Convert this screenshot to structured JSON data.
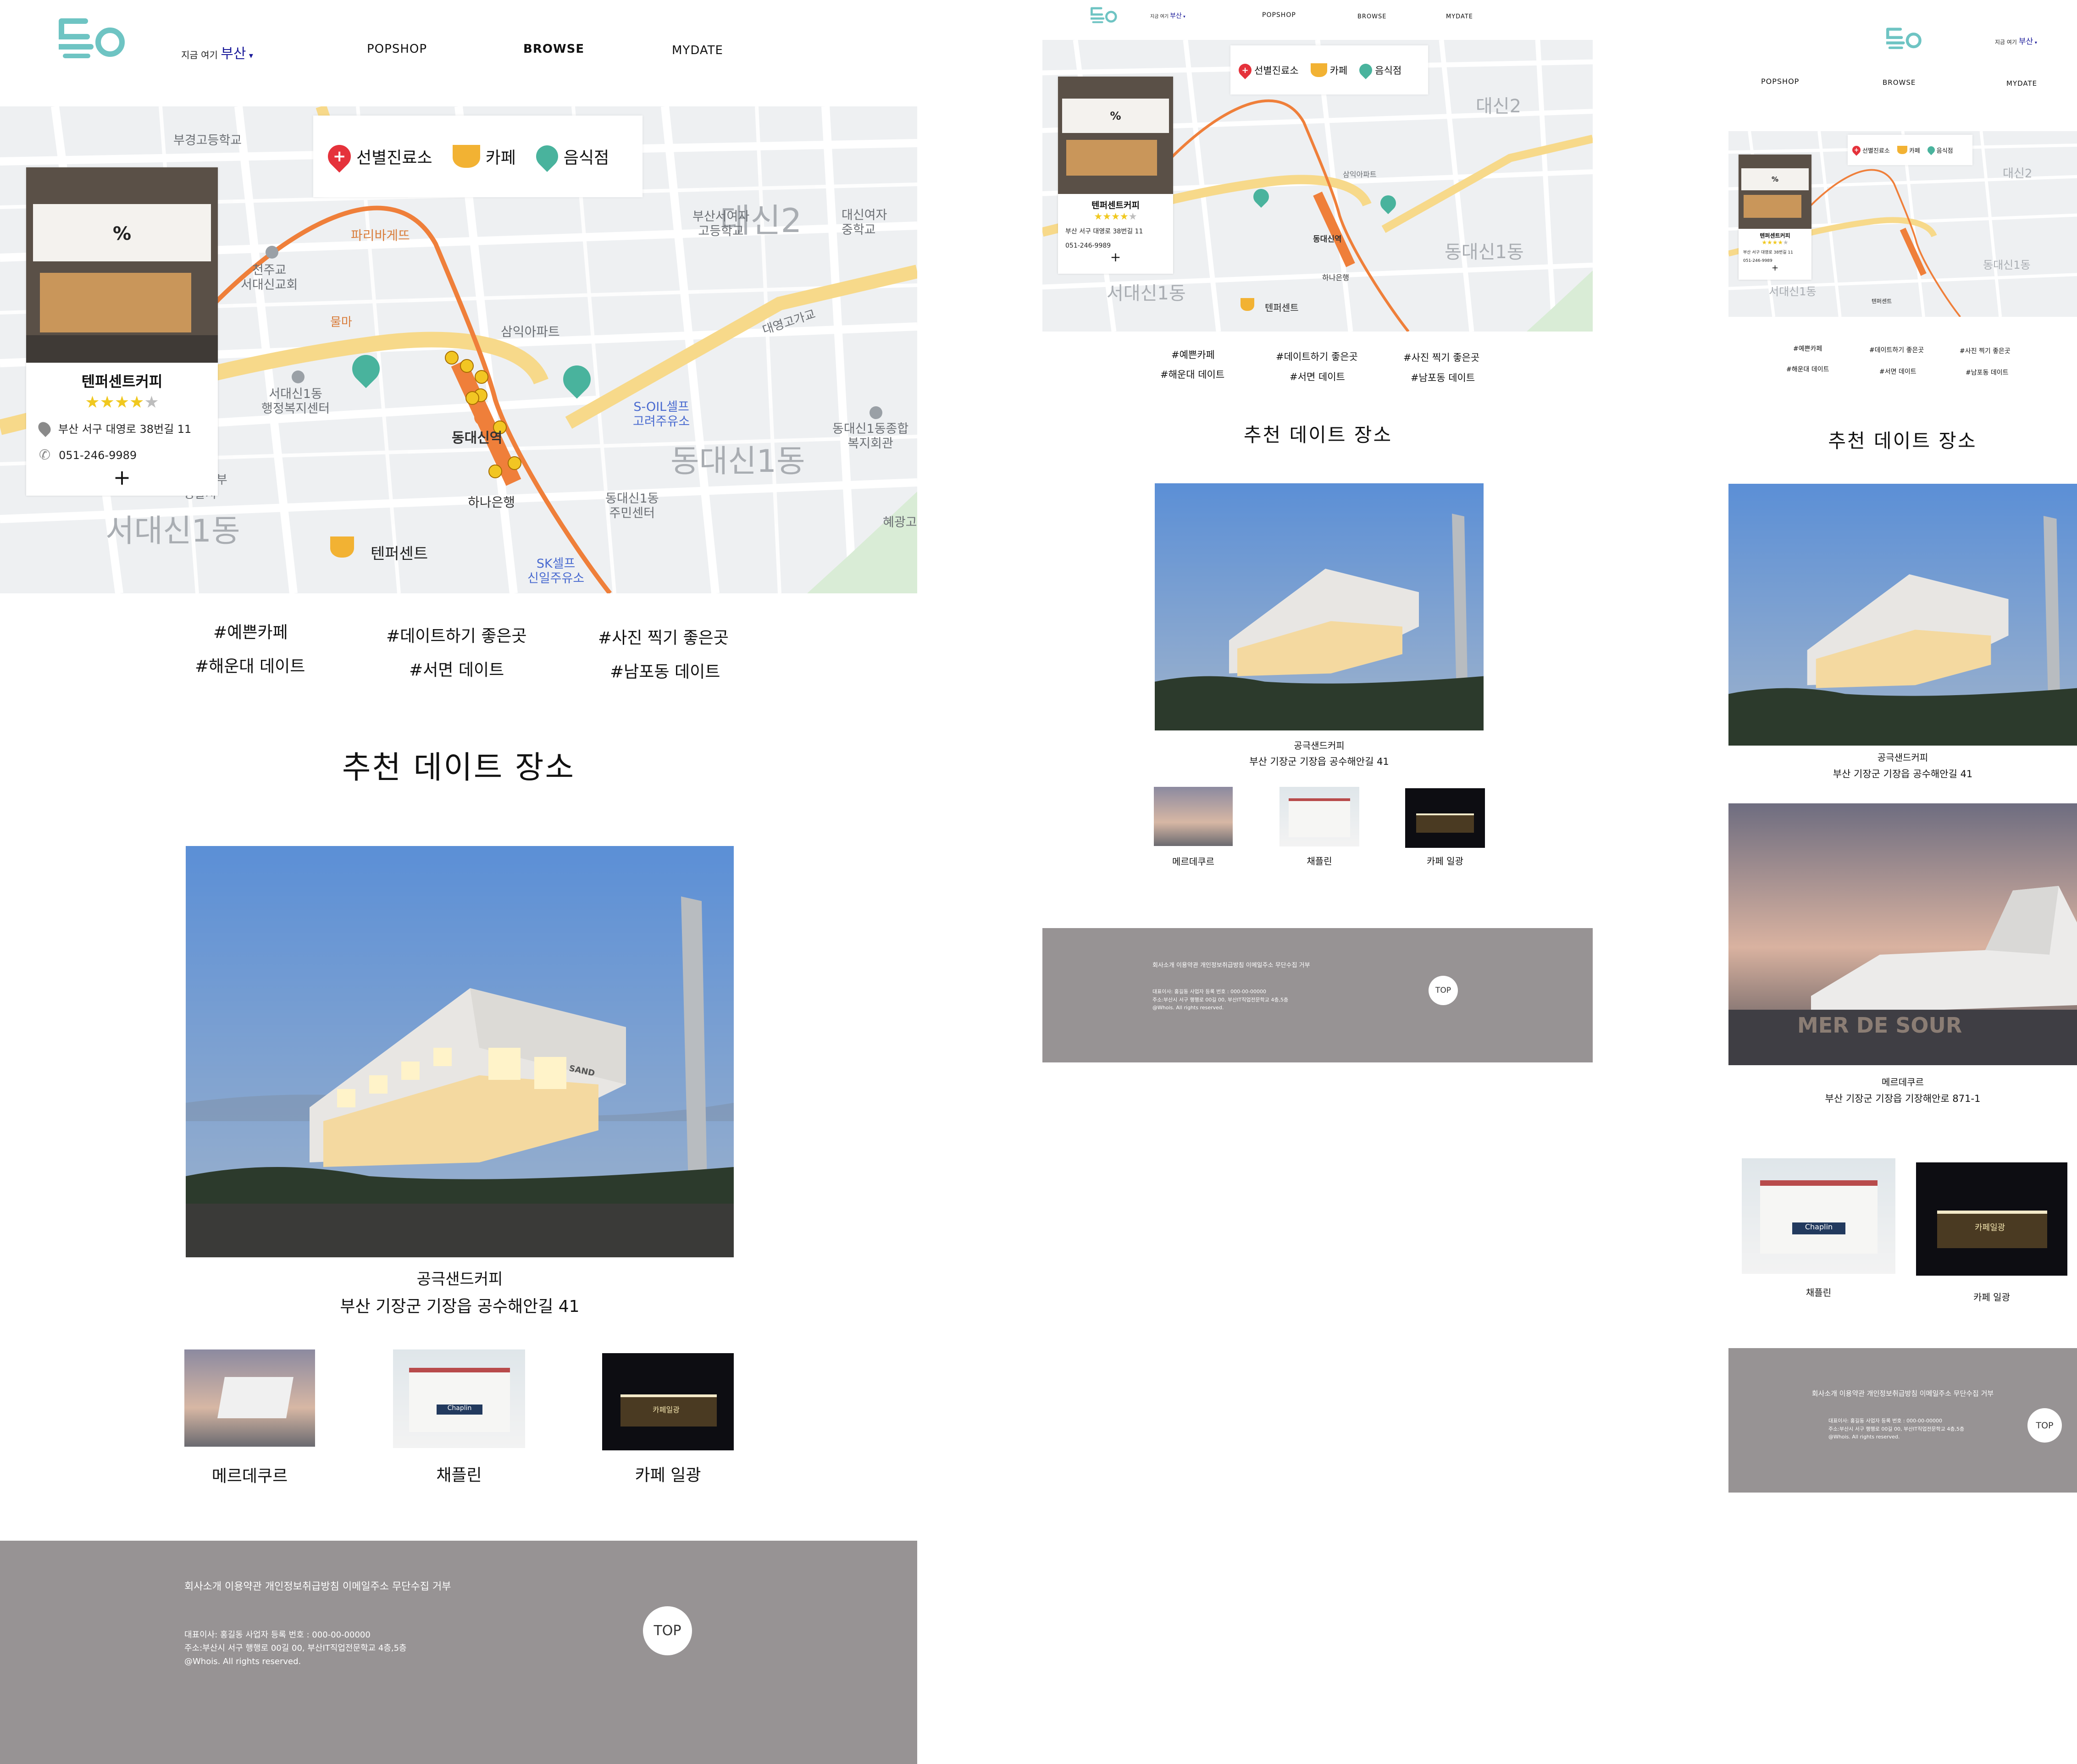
{
  "header": {
    "loc_now": "지금 여기",
    "loc_city": "부산",
    "loc_caret": "▾",
    "nav_popshop": "POPSHOP",
    "nav_browse": "BROWSE",
    "nav_mydate": "MYDATE"
  },
  "legend": {
    "clinic": "선별진료소",
    "cafe": "카페",
    "restaurant": "음식점"
  },
  "map_labels": {
    "busan_girls_hs": "부경고등학교",
    "dae_shin2": "대신2",
    "daeshin_girls": "대신여자\n중학교",
    "seo_girls_hs": "부산서여자\n고등학교",
    "daeyeong_ro": "대영고가교",
    "paris": "파리바게뜨",
    "church": "천주교\n서대신교회",
    "samik": "삼익아파트",
    "daeshin_st": "동대신역",
    "hana": "하나은행",
    "seodaeshin1": "서대신1동",
    "seodaeshin1_office": "서대신1동\n행정복지센터",
    "soil": "S-OIL셀프\n고려주유소",
    "dongdaeshin1": "동대신1동",
    "dongdaeshin1_center": "동대신1동\n주민센터",
    "dongdaeshin1_welfare": "동대신1동종합\n복지회관",
    "sk": "SK셀프\n신일주유소",
    "seobu_police": "부산서부\n경찰서",
    "hyegwang": "혜광고",
    "tenpercent_marker": "텐퍼센트",
    "mulma": "물마"
  },
  "card": {
    "sign_text": "%",
    "name": "텐퍼센트커피",
    "stars_on": "★★★★",
    "stars_off": "★",
    "address": "부산 서구 대영로 38번길 11",
    "phone": "051-246-9989",
    "plus": "+"
  },
  "tags": {
    "t1": "#예쁜카페",
    "t2": "#데이트하기 좋은곳",
    "t3": "#사진 찍기 좋은곳",
    "t4": "#해운대 데이트",
    "t5": "#서면 데이트",
    "t6": "#남포동 데이트"
  },
  "section_title": "추천 데이트 장소",
  "featured": {
    "sign": "SAND\nCOFFEE",
    "name": "공극샌드커피",
    "address": "부산 기장군 기장읍 공수해안길 41"
  },
  "second_place": {
    "sign": "MER DE SOUR",
    "name": "메르데쿠르",
    "address": "부산 기장군 기장읍 기장해안로 871-1"
  },
  "thumbs": {
    "t1": "메르데쿠르",
    "t2": "채플린",
    "t3": "카페 일광",
    "t2_sign": "Chaplin",
    "t3_sign": "카페일광"
  },
  "footer": {
    "links": "회사소개  이용약관  개인정보취급방침  이메일주소 무단수집 거부",
    "line1": "대표이사: 홍길동    사업자 등록 번호 : 000-00-00000",
    "line2": "주소:부산시 서구 행행로 00길 00, 부산IT직업전문학교 4층,5층",
    "line3": "@Whois. All rights reserved.",
    "top": "TOP"
  },
  "colors": {
    "logo": "#6ec4c3",
    "route": "#ef7f3a",
    "footer": "#979394",
    "pin_red": "#e5323b",
    "pin_teal": "#49b39d",
    "cup": "#f2b233"
  }
}
